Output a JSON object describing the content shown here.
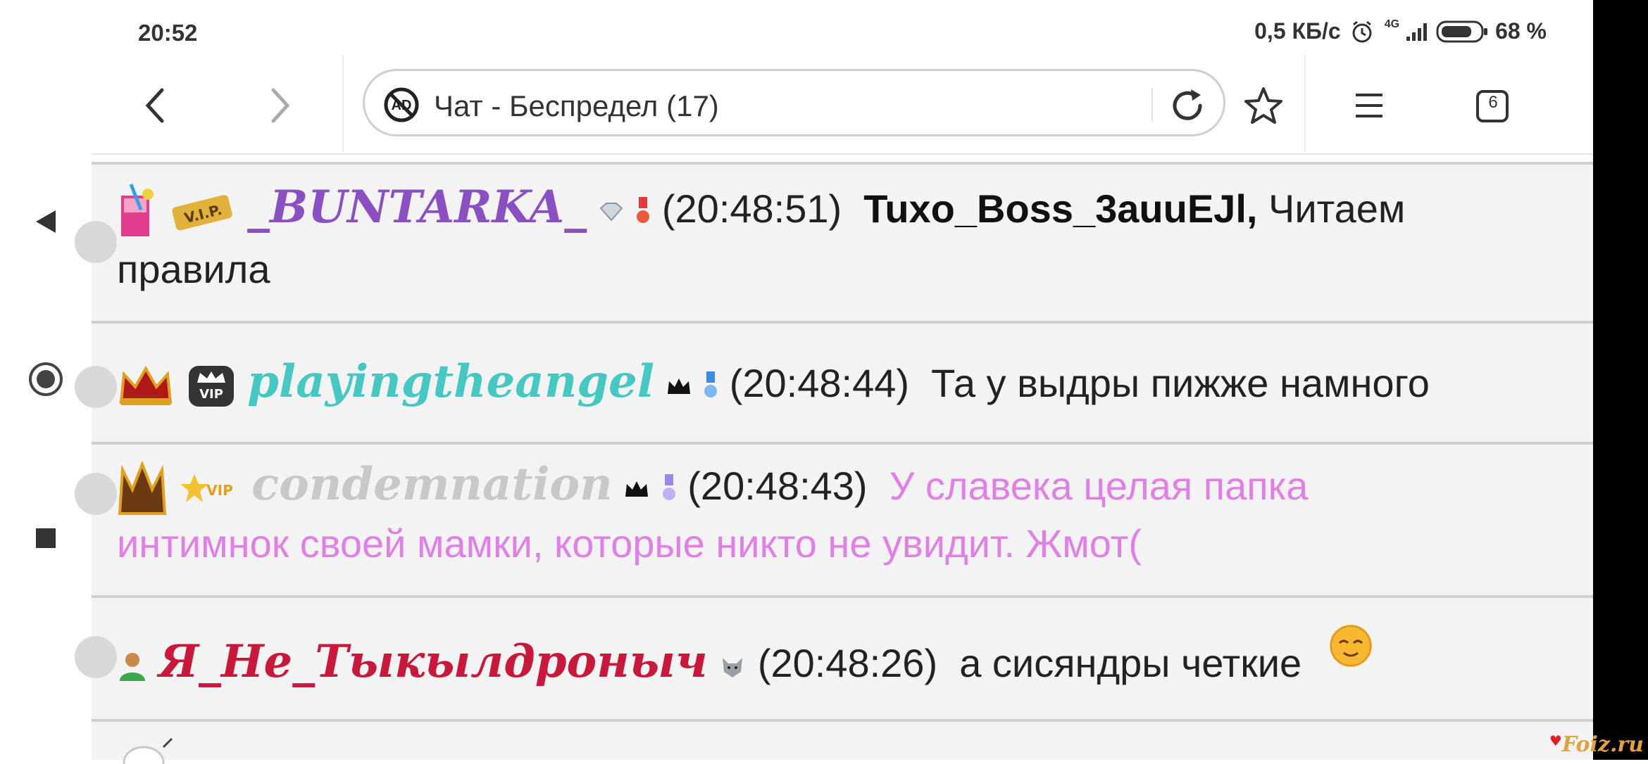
{
  "status": {
    "time": "20:52",
    "net_speed": "0,5 КБ/с",
    "network_type": "4G",
    "battery": "68 %"
  },
  "browser": {
    "url_title": "Чат - Беспредел (17)",
    "tabs_count": "6",
    "icons": [
      "back-arrow-icon",
      "forward-arrow-icon",
      "adblock-icon",
      "reload-icon",
      "star-icon",
      "menu-icon",
      "tabs-icon",
      "home-icon"
    ]
  },
  "messages": [
    {
      "nick": "_BUNTARKA_",
      "nick_color": "#8a4fc0",
      "time": "(20:48:51)",
      "addressee": "Tuxo_Boss_3auuEJl,",
      "text": "Читаем",
      "text2": "правила",
      "text_color": "#111111"
    },
    {
      "nick": "playingtheangel",
      "nick_color": "#46c8c2",
      "time": "(20:48:44)",
      "text": "Та у выдры пижже намного",
      "text_color": "#111111"
    },
    {
      "nick": "condemnation",
      "nick_color": "#c8c8c8",
      "time": "(20:48:43)",
      "text": "У славека целая папка",
      "text2": "интимнок своей мамки, которые никто не увидит. Жмот(",
      "text_color": "#e07fe6"
    },
    {
      "nick": "Я_Не_Тыкылдроныч",
      "nick_color": "#c8183b",
      "time": "(20:48:26)",
      "text": "а сисяндры четкие",
      "text_color": "#111111"
    }
  ],
  "watermark": "Foiz.ru"
}
